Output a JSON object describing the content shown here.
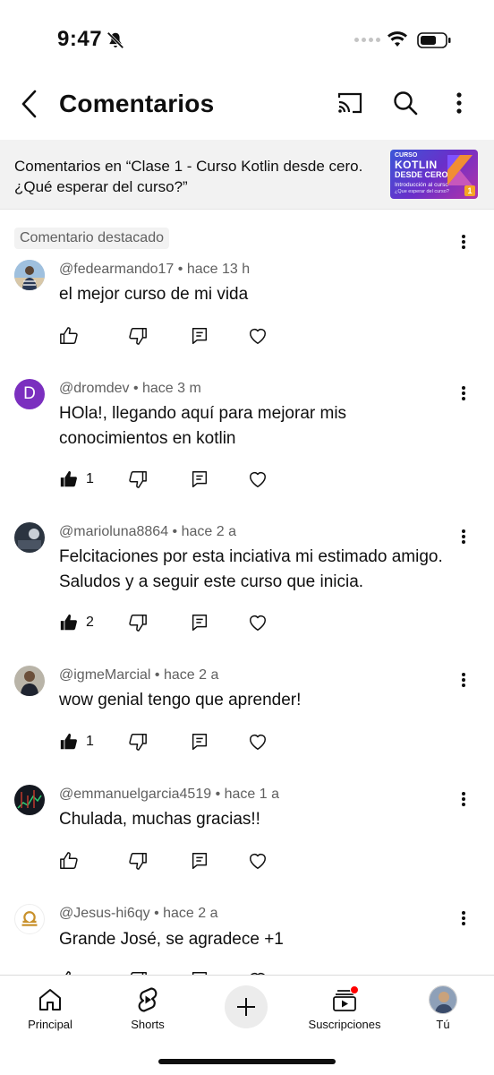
{
  "status_bar": {
    "time": "9:47",
    "icons": [
      "bell-off-icon",
      "signal-icon",
      "wifi-icon",
      "battery-icon"
    ]
  },
  "header": {
    "title": "Comentarios",
    "icons": [
      "back-icon",
      "cast-icon",
      "search-icon",
      "more-vert-icon"
    ]
  },
  "video": {
    "text": "Comentarios en “Clase 1 - Curso Kotlin desde cero. ¿Qué esperar del curso?”",
    "thumbnail": {
      "line1": "CURSO",
      "line2": "KOTLIN",
      "line3": "DESDE CERO",
      "line4": "Introducción al curso",
      "line5": "¿Que esperar del curso?",
      "number": "1"
    }
  },
  "featured_label": "Comentario destacado",
  "comments": [
    {
      "author": "@fedearmando17",
      "time": "hace 13 h",
      "meta": "@fedearmando17 • hace 13 h",
      "text": "el mejor curso de mi vida",
      "likes": "",
      "liked": false
    },
    {
      "author": "@dromdev",
      "time": "hace 3 m",
      "meta": "@dromdev • hace 3 m",
      "text": "HOla!, llegando aquí para mejorar mis conocimientos en kotlin",
      "likes": "1",
      "liked": true,
      "avatar_letter": "D"
    },
    {
      "author": "@marioluna8864",
      "time": "hace 2 a",
      "meta": "@marioluna8864 • hace 2 a",
      "text": "Felcitaciones por esta inciativa mi estimado amigo. Saludos y a seguir este curso que inicia.",
      "likes": "2",
      "liked": true
    },
    {
      "author": "@igmeMarcial",
      "time": "hace 2 a",
      "meta": "@igmeMarcial • hace 2 a",
      "text": "wow genial tengo que aprender!",
      "likes": "1",
      "liked": true
    },
    {
      "author": "@emmanuelgarcia4519",
      "time": "hace 1 a",
      "meta": "@emmanuelgarcia4519 • hace 1 a",
      "text": "Chulada, muchas gracias!!",
      "likes": "",
      "liked": false
    },
    {
      "author": "@Jesus-hi6qy",
      "time": "hace 2 a",
      "meta": "@Jesus-hi6qy • hace 2 a",
      "text": "Grande José, se agradece +1",
      "likes": "",
      "liked": false
    }
  ],
  "bottom_nav": {
    "home": "Principal",
    "shorts": "Shorts",
    "subscriptions": "Suscripciones",
    "you": "Tú"
  },
  "colors": {
    "text": "#0f0f0f",
    "secondary_text": "#606060",
    "band_bg": "#f2f2f2",
    "avatar_purple": "#7b2fbf",
    "notification_red": "#ff0000"
  }
}
